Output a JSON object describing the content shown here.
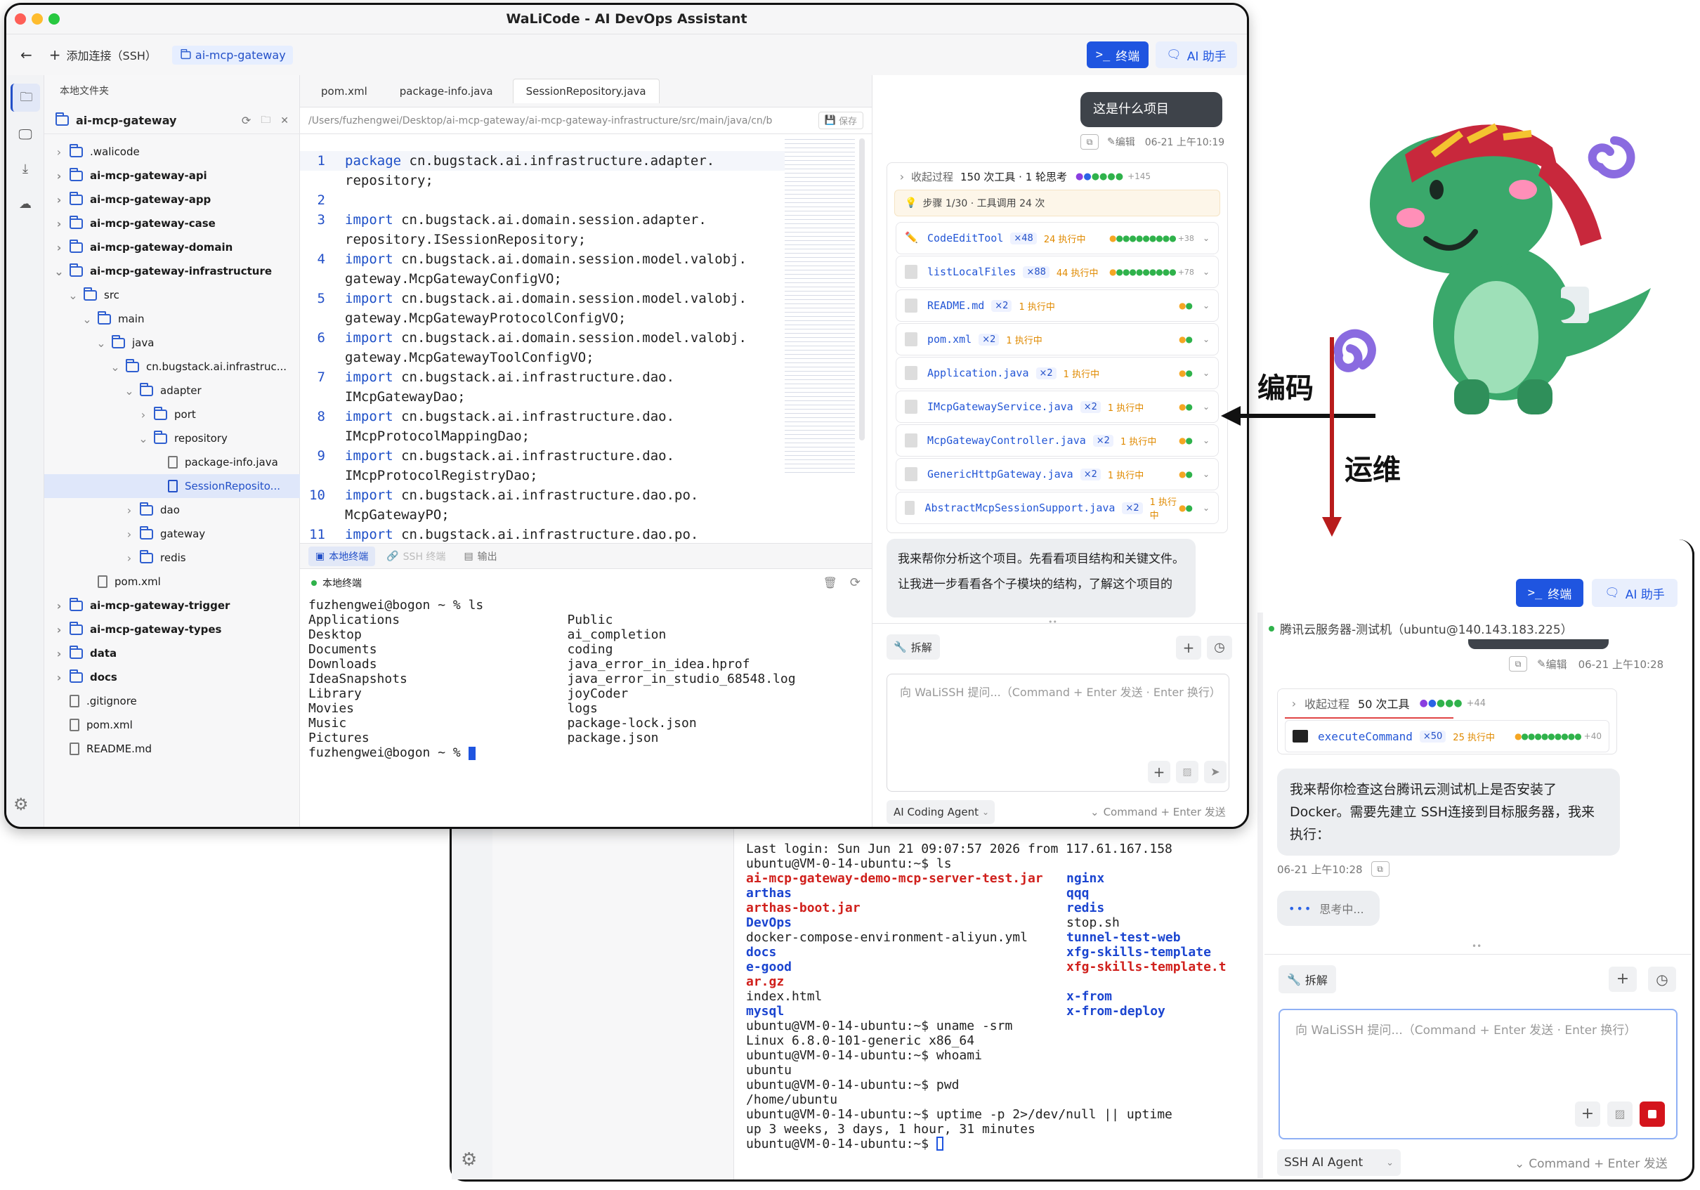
{
  "top_window": {
    "title": "WaLiCode - AI DevOps Assistant",
    "add_connection": "添加连接（SSH）",
    "project_tab": "ai-mcp-gateway",
    "terminal_btn": "终端",
    "ai_btn": "AI 助手",
    "explorer_title": "本地文件夹",
    "root_folder": "ai-mcp-gateway",
    "tree": [
      {
        "name": ".walicode",
        "type": "folder",
        "depth": 0,
        "bold": false,
        "chev": "›"
      },
      {
        "name": "ai-mcp-gateway-api",
        "type": "folder",
        "depth": 0,
        "bold": true,
        "chev": "›"
      },
      {
        "name": "ai-mcp-gateway-app",
        "type": "folder",
        "depth": 0,
        "bold": true,
        "chev": "›"
      },
      {
        "name": "ai-mcp-gateway-case",
        "type": "folder",
        "depth": 0,
        "bold": true,
        "chev": "›"
      },
      {
        "name": "ai-mcp-gateway-domain",
        "type": "folder",
        "depth": 0,
        "bold": true,
        "chev": "›"
      },
      {
        "name": "ai-mcp-gateway-infrastructure",
        "type": "folder",
        "depth": 0,
        "bold": true,
        "chev": "⌄"
      },
      {
        "name": "src",
        "type": "folder",
        "depth": 1,
        "bold": false,
        "chev": "⌄"
      },
      {
        "name": "main",
        "type": "folder",
        "depth": 2,
        "bold": false,
        "chev": "⌄"
      },
      {
        "name": "java",
        "type": "folder",
        "depth": 3,
        "bold": false,
        "chev": "⌄"
      },
      {
        "name": "cn.bugstack.ai.infrastruc...",
        "type": "folder",
        "depth": 4,
        "bold": false,
        "chev": "⌄"
      },
      {
        "name": "adapter",
        "type": "folder",
        "depth": 5,
        "bold": false,
        "chev": "⌄"
      },
      {
        "name": "port",
        "type": "folder",
        "depth": 6,
        "bold": false,
        "chev": "›"
      },
      {
        "name": "repository",
        "type": "folder",
        "depth": 6,
        "bold": false,
        "chev": "⌄"
      },
      {
        "name": "package-info.java",
        "type": "file",
        "depth": 7,
        "bold": false,
        "chev": ""
      },
      {
        "name": "SessionReposito...",
        "type": "file",
        "depth": 7,
        "bold": false,
        "chev": "",
        "selected": true
      },
      {
        "name": "dao",
        "type": "folder",
        "depth": 5,
        "bold": false,
        "chev": "›"
      },
      {
        "name": "gateway",
        "type": "folder",
        "depth": 5,
        "bold": false,
        "chev": "›"
      },
      {
        "name": "redis",
        "type": "folder",
        "depth": 5,
        "bold": false,
        "chev": "›"
      },
      {
        "name": "pom.xml",
        "type": "file",
        "depth": 2,
        "bold": false,
        "chev": ""
      },
      {
        "name": "ai-mcp-gateway-trigger",
        "type": "folder",
        "depth": 0,
        "bold": true,
        "chev": "›"
      },
      {
        "name": "ai-mcp-gateway-types",
        "type": "folder",
        "depth": 0,
        "bold": true,
        "chev": "›"
      },
      {
        "name": "data",
        "type": "folder",
        "depth": 0,
        "bold": true,
        "chev": "›"
      },
      {
        "name": "docs",
        "type": "folder",
        "depth": 0,
        "bold": true,
        "chev": "›"
      },
      {
        "name": ".gitignore",
        "type": "file",
        "depth": 0,
        "bold": false,
        "chev": ""
      },
      {
        "name": "pom.xml",
        "type": "file",
        "depth": 0,
        "bold": false,
        "chev": ""
      },
      {
        "name": "README.md",
        "type": "file",
        "depth": 0,
        "bold": false,
        "chev": ""
      }
    ],
    "editor_tabs": [
      "pom.xml",
      "package-info.java",
      "SessionRepository.java"
    ],
    "path": "/Users/fuzhengwei/Desktop/ai-mcp-gateway/ai-mcp-gateway-infrastructure/src/main/java/cn/b...",
    "save": "保存",
    "code": [
      {
        "n": "1",
        "kw": "package",
        "rest": " cn.bugstack.ai.infrastructure.adapter."
      },
      {
        "n": "",
        "kw": "",
        "rest": "repository;"
      },
      {
        "n": "2",
        "kw": "",
        "rest": ""
      },
      {
        "n": "3",
        "kw": "import",
        "rest": " cn.bugstack.ai.domain.session.adapter."
      },
      {
        "n": "",
        "kw": "",
        "rest": "repository.ISessionRepository;"
      },
      {
        "n": "4",
        "kw": "import",
        "rest": " cn.bugstack.ai.domain.session.model.valobj."
      },
      {
        "n": "",
        "kw": "",
        "rest": "gateway.McpGatewayConfigVO;"
      },
      {
        "n": "5",
        "kw": "import",
        "rest": " cn.bugstack.ai.domain.session.model.valobj."
      },
      {
        "n": "",
        "kw": "",
        "rest": "gateway.McpGatewayProtocolConfigVO;"
      },
      {
        "n": "6",
        "kw": "import",
        "rest": " cn.bugstack.ai.domain.session.model.valobj."
      },
      {
        "n": "",
        "kw": "",
        "rest": "gateway.McpGatewayToolConfigVO;"
      },
      {
        "n": "7",
        "kw": "import",
        "rest": " cn.bugstack.ai.infrastructure.dao."
      },
      {
        "n": "",
        "kw": "",
        "rest": "IMcpGatewayDao;"
      },
      {
        "n": "8",
        "kw": "import",
        "rest": " cn.bugstack.ai.infrastructure.dao."
      },
      {
        "n": "",
        "kw": "",
        "rest": "IMcpProtocolMappingDao;"
      },
      {
        "n": "9",
        "kw": "import",
        "rest": " cn.bugstack.ai.infrastructure.dao."
      },
      {
        "n": "",
        "kw": "",
        "rest": "IMcpProtocolRegistryDao;"
      },
      {
        "n": "10",
        "kw": "import",
        "rest": " cn.bugstack.ai.infrastructure.dao.po."
      },
      {
        "n": "",
        "kw": "",
        "rest": "McpGatewayPO;"
      },
      {
        "n": "11",
        "kw": "import",
        "rest": " cn.bugstack.ai.infrastructure.dao.po."
      }
    ],
    "term_tabs": [
      "本地终端",
      "SSH 终端",
      "输出"
    ],
    "term_title": "本地终端",
    "term_lines": [
      "fuzhengwei@bogon ~ % ls",
      "Applications                      Public",
      "Desktop                           ai_completion",
      "Documents                         coding",
      "Downloads                         java_error_in_idea.hprof",
      "IdeaSnapshots                     java_error_in_studio_68548.log",
      "Library                           joyCoder",
      "Movies                            logs",
      "Music                             package-lock.json",
      "Pictures                          package.json",
      "fuzhengwei@bogon ~ % "
    ],
    "chat": {
      "user_msg": "这是什么项目",
      "edit": "编辑",
      "time": "06-21 上午10:19",
      "collapse": "收起过程",
      "summary": "150 次工具 · 1 轮思考",
      "summary_more": "+145",
      "step": "步骤 1/30 · 工具调用 24 次",
      "tools": [
        {
          "name": "CodeEditTool",
          "count": "×48",
          "run": "24 执行中",
          "more": "+38",
          "icon": "✏️"
        },
        {
          "name": "listLocalFiles",
          "count": "×88",
          "run": "44 执行中",
          "more": "+78",
          "icon": ""
        },
        {
          "name": "README.md",
          "count": "×2",
          "run": "1 执行中",
          "more": "",
          "icon": ""
        },
        {
          "name": "pom.xml",
          "count": "×2",
          "run": "1 执行中",
          "more": "",
          "icon": ""
        },
        {
          "name": "Application.java",
          "count": "×2",
          "run": "1 执行中",
          "more": "",
          "icon": ""
        },
        {
          "name": "IMcpGatewayService.java",
          "count": "×2",
          "run": "1 执行中",
          "more": "",
          "icon": ""
        },
        {
          "name": "McpGatewayController.java",
          "count": "×2",
          "run": "1 执行中",
          "more": "",
          "icon": ""
        },
        {
          "name": "GenericHttpGateway.java",
          "count": "×2",
          "run": "1 执行中",
          "more": "",
          "icon": ""
        },
        {
          "name": "AbstractMcpSessionSupport.java",
          "count": "×2",
          "run": "1 执行中",
          "more": "",
          "icon": ""
        }
      ],
      "reply1": "我来帮你分析这个项目。先看看项目结构和关键文件。",
      "reply2": "让我进一步看看各个子模块的结构，了解这个项目的",
      "split": "拆解",
      "placeholder": "向 WaLiSSH 提问...（Command + Enter 发送 · Enter 换行）",
      "agent": "AI Coding Agent",
      "send_hint": "Command + Enter 发送"
    }
  },
  "bottom_window": {
    "terminal_btn": "终端",
    "ai_btn": "AI 助手",
    "server": "腾讯云服务器-测试机（ubuntu@140.143.183.225）",
    "edit": "编辑",
    "time": "06-21 上午10:28",
    "collapse": "收起过程",
    "summary": "50 次工具",
    "summary_more": "+44",
    "tool": {
      "name": "executeCommand",
      "count": "×50",
      "run": "25 执行中",
      "more": "+40"
    },
    "reply": "我来帮你检查这台腾讯云测试机上是否安装了Docker。需要先建立 SSH连接到目标服务器，我来执行：",
    "reply_time": "06-21 上午10:28",
    "thinking": "思考中...",
    "split": "拆解",
    "placeholder": "向 WaLiSSH 提问...（Command + Enter 发送 · Enter 换行）",
    "agent": "SSH AI Agent",
    "send_hint": "Command + Enter 发送",
    "terminal": [
      [
        {
          "t": "Last login: Sun Jun 21 09:07:57 2026 from 117.61.167.158",
          "c": ""
        }
      ],
      [
        {
          "t": "ubuntu@VM-0-14-ubuntu:~$ ls",
          "c": ""
        }
      ],
      [
        {
          "t": "ai-mcp-gateway-demo-mcp-server-test.jar",
          "c": "red"
        },
        {
          "t": "nginx",
          "c": "blu"
        }
      ],
      [
        {
          "t": "arthas",
          "c": "blu"
        },
        {
          "t": "qqq",
          "c": "blu"
        }
      ],
      [
        {
          "t": "arthas-boot.jar",
          "c": "red"
        },
        {
          "t": "redis",
          "c": "blu"
        }
      ],
      [
        {
          "t": "DevOps",
          "c": "blu"
        },
        {
          "t": "stop.sh",
          "c": ""
        }
      ],
      [
        {
          "t": "docker-compose-environment-aliyun.yml",
          "c": ""
        },
        {
          "t": "tunnel-test-web",
          "c": "blu"
        }
      ],
      [
        {
          "t": "docs",
          "c": "blu"
        },
        {
          "t": "xfg-skills-template",
          "c": "blu"
        }
      ],
      [
        {
          "t": "e-good",
          "c": "blu"
        },
        {
          "t": "xfg-skills-template.t",
          "c": "red"
        }
      ],
      [
        {
          "t": "ar.gz",
          "c": "red"
        }
      ],
      [
        {
          "t": "index.html",
          "c": ""
        },
        {
          "t": "x-from",
          "c": "blu"
        }
      ],
      [
        {
          "t": "mysql",
          "c": "blu"
        },
        {
          "t": "x-from-deploy",
          "c": "blu"
        }
      ],
      [
        {
          "t": "ubuntu@VM-0-14-ubuntu:~$ uname -srm",
          "c": ""
        }
      ],
      [
        {
          "t": "Linux 6.8.0-101-generic x86_64",
          "c": ""
        }
      ],
      [
        {
          "t": "ubuntu@VM-0-14-ubuntu:~$ whoami",
          "c": ""
        }
      ],
      [
        {
          "t": "ubuntu",
          "c": ""
        }
      ],
      [
        {
          "t": "ubuntu@VM-0-14-ubuntu:~$ pwd",
          "c": ""
        }
      ],
      [
        {
          "t": "/home/ubuntu",
          "c": ""
        }
      ],
      [
        {
          "t": "ubuntu@VM-0-14-ubuntu:~$ uptime -p 2>/dev/null || uptime",
          "c": ""
        }
      ],
      [
        {
          "t": "up 3 weeks, 3 days, 1 hour, 31 minutes",
          "c": ""
        }
      ],
      [
        {
          "t": "ubuntu@VM-0-14-ubuntu:~$ ",
          "c": ""
        }
      ]
    ]
  },
  "labels": {
    "coding": "编码",
    "ops": "运维"
  },
  "colors": {
    "accent": "#1f55e0",
    "arrow_red": "#b81c1c",
    "dino": "#3aa86b"
  }
}
